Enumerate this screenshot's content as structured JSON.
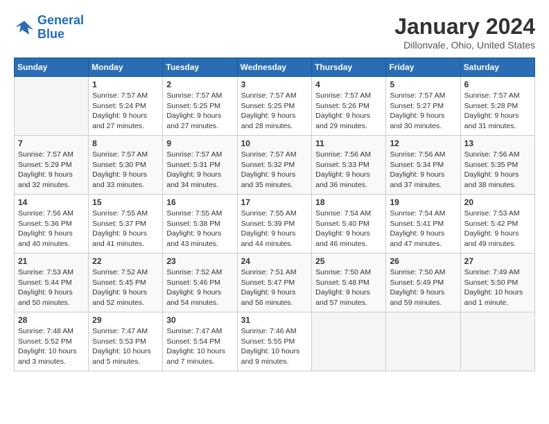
{
  "header": {
    "logo_line1": "General",
    "logo_line2": "Blue",
    "month_title": "January 2024",
    "location": "Dillonvale, Ohio, United States"
  },
  "days_of_week": [
    "Sunday",
    "Monday",
    "Tuesday",
    "Wednesday",
    "Thursday",
    "Friday",
    "Saturday"
  ],
  "weeks": [
    [
      {
        "day": "",
        "empty": true
      },
      {
        "day": "1",
        "sunrise": "7:57 AM",
        "sunset": "5:24 PM",
        "daylight": "9 hours and 27 minutes."
      },
      {
        "day": "2",
        "sunrise": "7:57 AM",
        "sunset": "5:25 PM",
        "daylight": "9 hours and 27 minutes."
      },
      {
        "day": "3",
        "sunrise": "7:57 AM",
        "sunset": "5:25 PM",
        "daylight": "9 hours and 28 minutes."
      },
      {
        "day": "4",
        "sunrise": "7:57 AM",
        "sunset": "5:26 PM",
        "daylight": "9 hours and 29 minutes."
      },
      {
        "day": "5",
        "sunrise": "7:57 AM",
        "sunset": "5:27 PM",
        "daylight": "9 hours and 30 minutes."
      },
      {
        "day": "6",
        "sunrise": "7:57 AM",
        "sunset": "5:28 PM",
        "daylight": "9 hours and 31 minutes."
      }
    ],
    [
      {
        "day": "7",
        "sunrise": "7:57 AM",
        "sunset": "5:29 PM",
        "daylight": "9 hours and 32 minutes."
      },
      {
        "day": "8",
        "sunrise": "7:57 AM",
        "sunset": "5:30 PM",
        "daylight": "9 hours and 33 minutes."
      },
      {
        "day": "9",
        "sunrise": "7:57 AM",
        "sunset": "5:31 PM",
        "daylight": "9 hours and 34 minutes."
      },
      {
        "day": "10",
        "sunrise": "7:57 AM",
        "sunset": "5:32 PM",
        "daylight": "9 hours and 35 minutes."
      },
      {
        "day": "11",
        "sunrise": "7:56 AM",
        "sunset": "5:33 PM",
        "daylight": "9 hours and 36 minutes."
      },
      {
        "day": "12",
        "sunrise": "7:56 AM",
        "sunset": "5:34 PM",
        "daylight": "9 hours and 37 minutes."
      },
      {
        "day": "13",
        "sunrise": "7:56 AM",
        "sunset": "5:35 PM",
        "daylight": "9 hours and 38 minutes."
      }
    ],
    [
      {
        "day": "14",
        "sunrise": "7:56 AM",
        "sunset": "5:36 PM",
        "daylight": "9 hours and 40 minutes."
      },
      {
        "day": "15",
        "sunrise": "7:55 AM",
        "sunset": "5:37 PM",
        "daylight": "9 hours and 41 minutes."
      },
      {
        "day": "16",
        "sunrise": "7:55 AM",
        "sunset": "5:38 PM",
        "daylight": "9 hours and 43 minutes."
      },
      {
        "day": "17",
        "sunrise": "7:55 AM",
        "sunset": "5:39 PM",
        "daylight": "9 hours and 44 minutes."
      },
      {
        "day": "18",
        "sunrise": "7:54 AM",
        "sunset": "5:40 PM",
        "daylight": "9 hours and 46 minutes."
      },
      {
        "day": "19",
        "sunrise": "7:54 AM",
        "sunset": "5:41 PM",
        "daylight": "9 hours and 47 minutes."
      },
      {
        "day": "20",
        "sunrise": "7:53 AM",
        "sunset": "5:42 PM",
        "daylight": "9 hours and 49 minutes."
      }
    ],
    [
      {
        "day": "21",
        "sunrise": "7:53 AM",
        "sunset": "5:44 PM",
        "daylight": "9 hours and 50 minutes."
      },
      {
        "day": "22",
        "sunrise": "7:52 AM",
        "sunset": "5:45 PM",
        "daylight": "9 hours and 52 minutes."
      },
      {
        "day": "23",
        "sunrise": "7:52 AM",
        "sunset": "5:46 PM",
        "daylight": "9 hours and 54 minutes."
      },
      {
        "day": "24",
        "sunrise": "7:51 AM",
        "sunset": "5:47 PM",
        "daylight": "9 hours and 56 minutes."
      },
      {
        "day": "25",
        "sunrise": "7:50 AM",
        "sunset": "5:48 PM",
        "daylight": "9 hours and 57 minutes."
      },
      {
        "day": "26",
        "sunrise": "7:50 AM",
        "sunset": "5:49 PM",
        "daylight": "9 hours and 59 minutes."
      },
      {
        "day": "27",
        "sunrise": "7:49 AM",
        "sunset": "5:50 PM",
        "daylight": "10 hours and 1 minute."
      }
    ],
    [
      {
        "day": "28",
        "sunrise": "7:48 AM",
        "sunset": "5:52 PM",
        "daylight": "10 hours and 3 minutes."
      },
      {
        "day": "29",
        "sunrise": "7:47 AM",
        "sunset": "5:53 PM",
        "daylight": "10 hours and 5 minutes."
      },
      {
        "day": "30",
        "sunrise": "7:47 AM",
        "sunset": "5:54 PM",
        "daylight": "10 hours and 7 minutes."
      },
      {
        "day": "31",
        "sunrise": "7:46 AM",
        "sunset": "5:55 PM",
        "daylight": "10 hours and 9 minutes."
      },
      {
        "day": "",
        "empty": true
      },
      {
        "day": "",
        "empty": true
      },
      {
        "day": "",
        "empty": true
      }
    ]
  ],
  "labels": {
    "sunrise": "Sunrise:",
    "sunset": "Sunset:",
    "daylight": "Daylight:"
  }
}
